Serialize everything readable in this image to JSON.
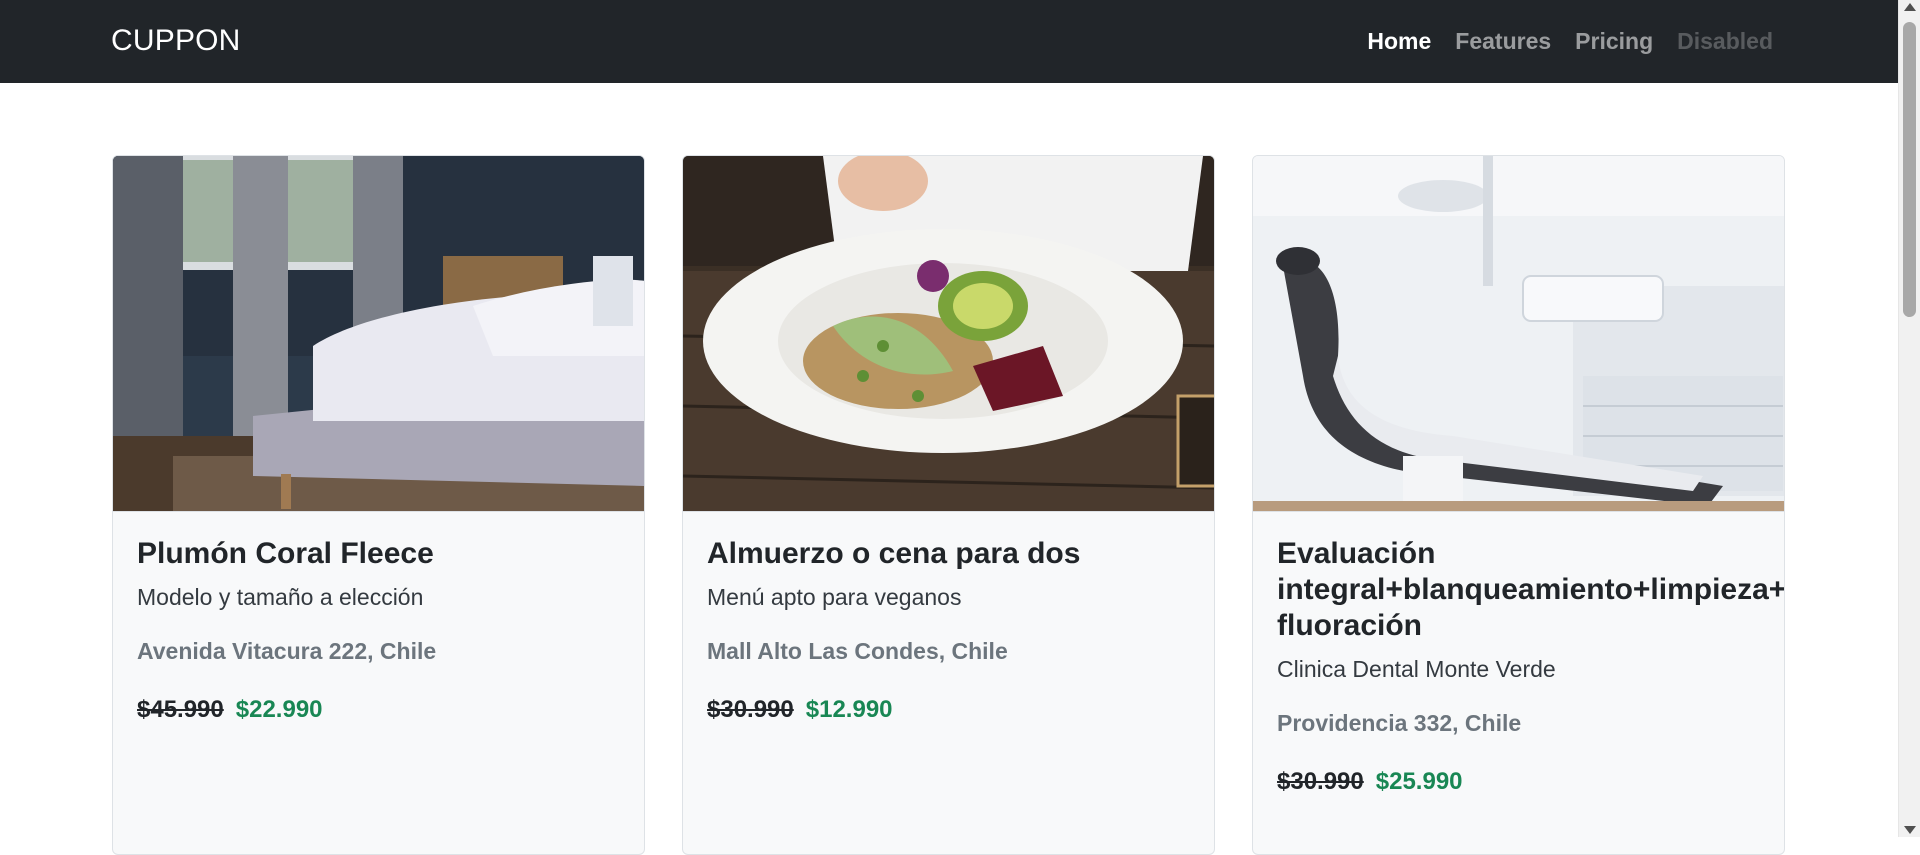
{
  "navbar": {
    "brand": "CUPPON",
    "links": [
      {
        "label": "Home",
        "state": "active"
      },
      {
        "label": "Features",
        "state": "normal"
      },
      {
        "label": "Pricing",
        "state": "normal"
      },
      {
        "label": "Disabled",
        "state": "disabled"
      }
    ]
  },
  "colors": {
    "navbar_bg": "#212529",
    "card_bg": "#f8f9fa",
    "price_new": "#198754",
    "location_text": "#6c757d"
  },
  "cards": [
    {
      "image": "bedroom-bed-photo",
      "title": "Plumón Coral Fleece",
      "subtitle": "Modelo y tamaño a elección",
      "location": "Avenida Vitacura 222, Chile",
      "old_price": "$45.990",
      "new_price": "$22.990"
    },
    {
      "image": "vegan-salad-plate-photo",
      "title": "Almuerzo o cena para dos",
      "subtitle": "Menú apto para veganos",
      "location": "Mall Alto Las Condes, Chile",
      "old_price": "$30.990",
      "new_price": "$12.990"
    },
    {
      "image": "dental-chair-photo",
      "title": "Evaluación integral+blanqueamiento+limpieza+ fluoración",
      "subtitle": "Clinica Dental Monte Verde",
      "location": "Providencia 332, Chile",
      "old_price": "$30.990",
      "new_price": "$25.990"
    }
  ]
}
